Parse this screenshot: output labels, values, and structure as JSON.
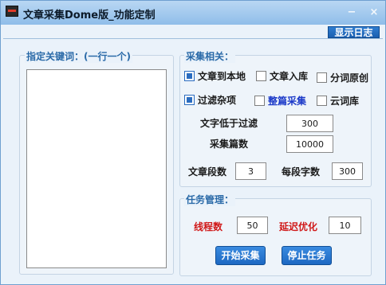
{
  "window": {
    "title": "文章采集Dome版_功能定制",
    "minimize_glyph": "−",
    "close_glyph": "×",
    "app_icon": "app-logo-icon"
  },
  "toolbar": {
    "log_button": "显示日志"
  },
  "keywords": {
    "legend": "指定关键词：(一行一个)",
    "value": ""
  },
  "collect": {
    "legend": "采集相关：",
    "options": [
      {
        "label": "文章到本地",
        "checked": true
      },
      {
        "label": "文章入库",
        "checked": false
      },
      {
        "label": "分词原创",
        "checked": false
      },
      {
        "label": "过滤杂项",
        "checked": true
      },
      {
        "label": "整篇采集",
        "checked": false
      },
      {
        "label": "云词库",
        "checked": false
      }
    ],
    "filter_label": "文字低于过滤",
    "filter_value": "300",
    "count_label": "采集篇数",
    "count_value": "10000",
    "paragraphs_label": "文章段数",
    "paragraphs_value": "3",
    "words_label": "每段字数",
    "words_value": "300"
  },
  "task": {
    "legend": "任务管理：",
    "threads_label": "线程数",
    "threads_value": "50",
    "delay_label": "延迟优化",
    "delay_value": "10",
    "start_button": "开始采集",
    "stop_button": "停止任务"
  },
  "colors": {
    "accent": "#1d68c2",
    "legend": "#2a6aa8",
    "warning_label": "#d01818",
    "highlight_label": "#1a38c8"
  }
}
